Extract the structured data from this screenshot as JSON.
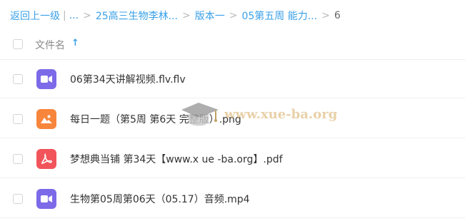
{
  "breadcrumb": {
    "items": [
      {
        "label": "返回上一级",
        "type": "link"
      },
      {
        "label": "...",
        "type": "link"
      },
      {
        "label": "25高三生物李林...",
        "type": "link"
      },
      {
        "label": "版本一",
        "type": "link"
      },
      {
        "label": "05第五周 能力...",
        "type": "link"
      },
      {
        "label": "6",
        "type": "current"
      }
    ],
    "divider": "|",
    "separator": ">"
  },
  "header": {
    "column_label": "文件名",
    "sort_icon": "arrow-up-icon",
    "sort_glyph": "↑"
  },
  "files": [
    {
      "name": "06第34天讲解视频.flv.flv",
      "icon": "video-file-icon",
      "color": "#7c6ae8"
    },
    {
      "name": "每日一题（第5周 第6天 完整版）.png",
      "icon": "image-file-icon",
      "color": "#f7853b"
    },
    {
      "name": "梦想典当铺 第34天【www.x ue -ba.org】.pdf",
      "icon": "pdf-file-icon",
      "color": "#f2545b"
    },
    {
      "name": "生物第05周第06天（05.17）音频.mp4",
      "icon": "video-file-icon",
      "color": "#7c6ae8"
    }
  ],
  "watermark": {
    "text": "www.xue-ba.org",
    "icon": "graduation-cap-logo"
  },
  "colors": {
    "link": "#3aa0e8",
    "video": "#7c6ae8",
    "image": "#f7853b",
    "pdf": "#f2545b"
  }
}
